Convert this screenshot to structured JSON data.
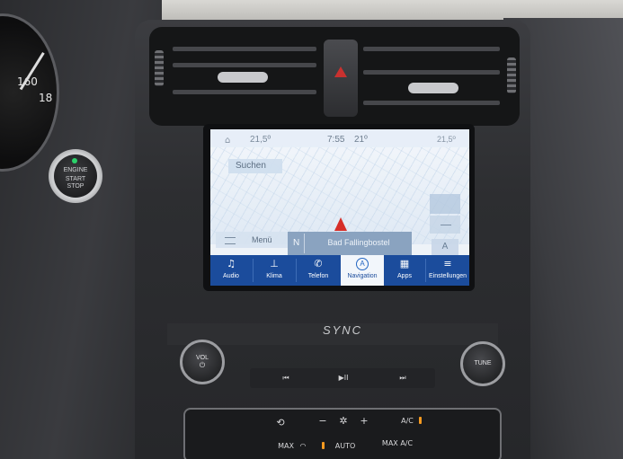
{
  "status_bar": {
    "home_icon": "home-icon",
    "temp_left": "21,5º",
    "time": "7:55",
    "temp_center": "21º",
    "temp_right": "21,5º"
  },
  "map": {
    "search_label": "Suchen",
    "menu_label": "Menü",
    "heading": "N",
    "street": "Bad Fallingbostel",
    "compass_icon": "compass-icon"
  },
  "dock": [
    {
      "label": "Audio",
      "icon": "music-note-icon",
      "glyph": "♫"
    },
    {
      "label": "Klima",
      "icon": "thermometer-icon",
      "glyph": "🌡"
    },
    {
      "label": "Telefon",
      "icon": "phone-icon",
      "glyph": "✆"
    },
    {
      "label": "Navigation",
      "icon": "navigation-icon",
      "glyph": "A",
      "active": true
    },
    {
      "label": "Apps",
      "icon": "apps-grid-icon",
      "glyph": "▦"
    },
    {
      "label": "Einstellungen",
      "icon": "settings-sliders-icon",
      "glyph": "≡"
    }
  ],
  "cluster": {
    "speed_mark_1": "160",
    "speed_mark_2": "18"
  },
  "start_stop": {
    "line1": "ENGINE",
    "line2": "START",
    "line3": "STOP"
  },
  "controls": {
    "sync_logo": "SYNC",
    "vol_label": "VOL",
    "power_glyph": "⏻",
    "tune_label": "TUNE",
    "prev_glyph": "⏮",
    "play_glyph": "▶II",
    "next_glyph": "⏭",
    "fan_minus": "−",
    "fan_plus": "+",
    "ac_label": "A/C",
    "max_defrost_label": "MAX",
    "auto_label": "AUTO",
    "max_ac_label": "MAX A/C"
  },
  "colors": {
    "dock_blue": "#1b4c9c",
    "hazard_red": "#c9312f",
    "indicator_orange": "#f59a20",
    "arrow_red": "#d62e28"
  }
}
